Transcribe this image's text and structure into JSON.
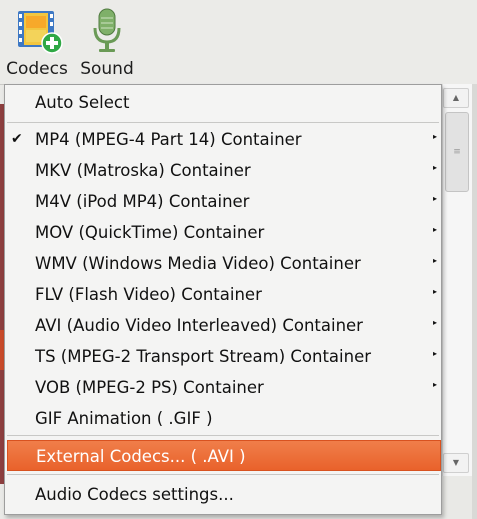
{
  "toolbar": {
    "codecs_label": "Codecs",
    "sound_label": "Sound"
  },
  "menu": {
    "items": [
      {
        "label": "Auto Select"
      },
      {
        "label": "MP4 (MPEG-4 Part 14) Container",
        "checked": true
      },
      {
        "label": "MKV (Matroska) Container"
      },
      {
        "label": "M4V (iPod MP4) Container"
      },
      {
        "label": "MOV (QuickTime) Container"
      },
      {
        "label": "WMV (Windows Media Video) Container"
      },
      {
        "label": "FLV (Flash Video) Container"
      },
      {
        "label": "AVI (Audio Video Interleaved) Container"
      },
      {
        "label": "TS (MPEG-2 Transport Stream) Container"
      },
      {
        "label": "VOB (MPEG-2 PS) Container"
      },
      {
        "label": "GIF Animation ( .GIF )"
      },
      {
        "label": "External Codecs... ( .AVI )",
        "highlighted": true
      },
      {
        "label": "Audio Codecs settings..."
      }
    ],
    "check_glyph": "✔",
    "submenu_arrow_glyph": "▸"
  },
  "scrollbar": {
    "up_glyph": "▲",
    "down_glyph": "▼",
    "grip_glyph": "≡"
  },
  "colors": {
    "highlight": "#ec6d36",
    "menu_background": "#f4f4f3",
    "toolbar_background": "#ebebe8"
  },
  "icons": {
    "codecs": "film-plus-icon",
    "sound": "microphone-icon"
  }
}
